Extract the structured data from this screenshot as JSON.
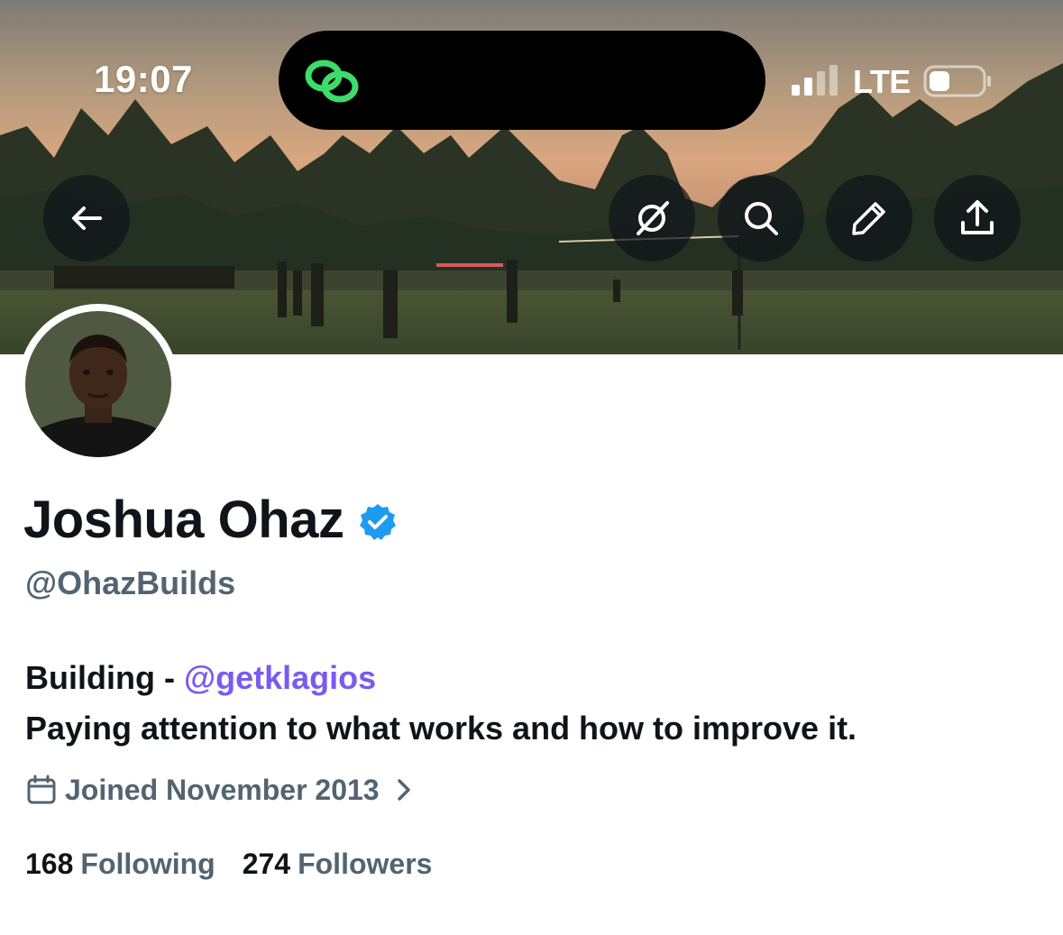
{
  "status_bar": {
    "time": "19:07",
    "network": "LTE",
    "island_app_icon": "link-rings-icon",
    "signal_icon": "cellular-signal-icon",
    "battery_icon": "battery-icon"
  },
  "header_actions": {
    "back_icon": "arrow-left-icon",
    "grok_icon": "grok-icon",
    "search_icon": "search-icon",
    "edit_icon": "pencil-icon",
    "share_icon": "share-icon"
  },
  "profile": {
    "display_name": "Joshua Ohaz",
    "verified": true,
    "verified_color": "#1d9bf0",
    "handle": "@OhazBuilds",
    "bio_line1_prefix": "Building - ",
    "bio_line1_link": "@getklagios",
    "bio_line2": "Paying attention to what works and how to improve it.",
    "joined": "Joined November 2013",
    "following_count": "168",
    "following_label": "Following",
    "followers_count": "274",
    "followers_label": "Followers"
  },
  "colors": {
    "text_primary": "#0f1419",
    "text_secondary": "#536471",
    "link": "#7a5af0",
    "island_accent": "#3ddc6b"
  }
}
